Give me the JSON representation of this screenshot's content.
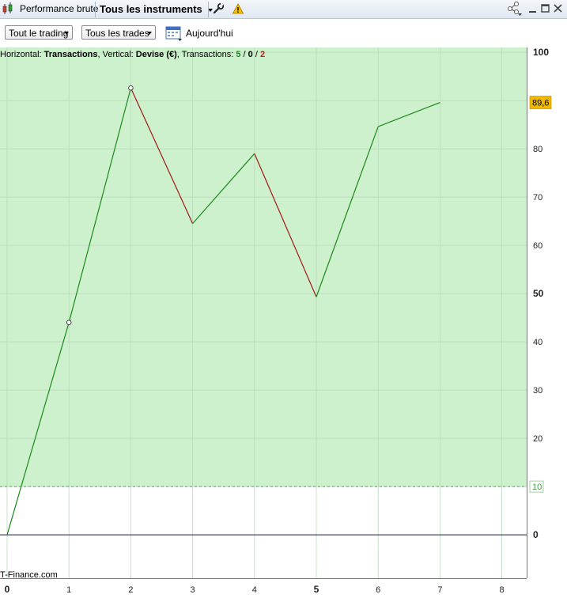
{
  "titlebar": {
    "panel_title": "Performance brute",
    "instrument_selector": "Tous les instruments",
    "colors": {
      "background": "#dfe7f1"
    }
  },
  "toolbar": {
    "filter_trading": "Tout le trading",
    "filter_trades": "Tous les trades",
    "date_label": "Aujourd'hui"
  },
  "info": {
    "prefix": "Horizontal: ",
    "h_value": "Transactions",
    "mid": ", Vertical: ",
    "v_value": "Devise (€)",
    "tx_label": ", Transactions: ",
    "win": "5",
    "slash1": " / ",
    "neutral": "0",
    "slash2": " / ",
    "loss": "2"
  },
  "watermark": "T-Finance.com",
  "chart_data": {
    "type": "line",
    "x": [
      0,
      1,
      2,
      3,
      4,
      5,
      6,
      7
    ],
    "y": [
      0,
      44,
      92.6,
      64.5,
      79,
      49.3,
      84.6,
      89.6
    ],
    "xlim": [
      0,
      8.6
    ],
    "ylim": [
      -9,
      101
    ],
    "x_ticks": [
      "0",
      "1",
      "2",
      "3",
      "4",
      "5",
      "6",
      "7",
      "8"
    ],
    "y_ticks": [
      "0",
      "10",
      "20",
      "30",
      "40",
      "50",
      "60",
      "70",
      "80",
      "90",
      "100"
    ],
    "last_value_label": "89,6",
    "threshold_value": 10,
    "threshold_label": "10",
    "colors": {
      "up": "#1a8a1a",
      "down": "#a01818",
      "zone": "#cdf0cd",
      "badge": "#f0b800"
    }
  }
}
